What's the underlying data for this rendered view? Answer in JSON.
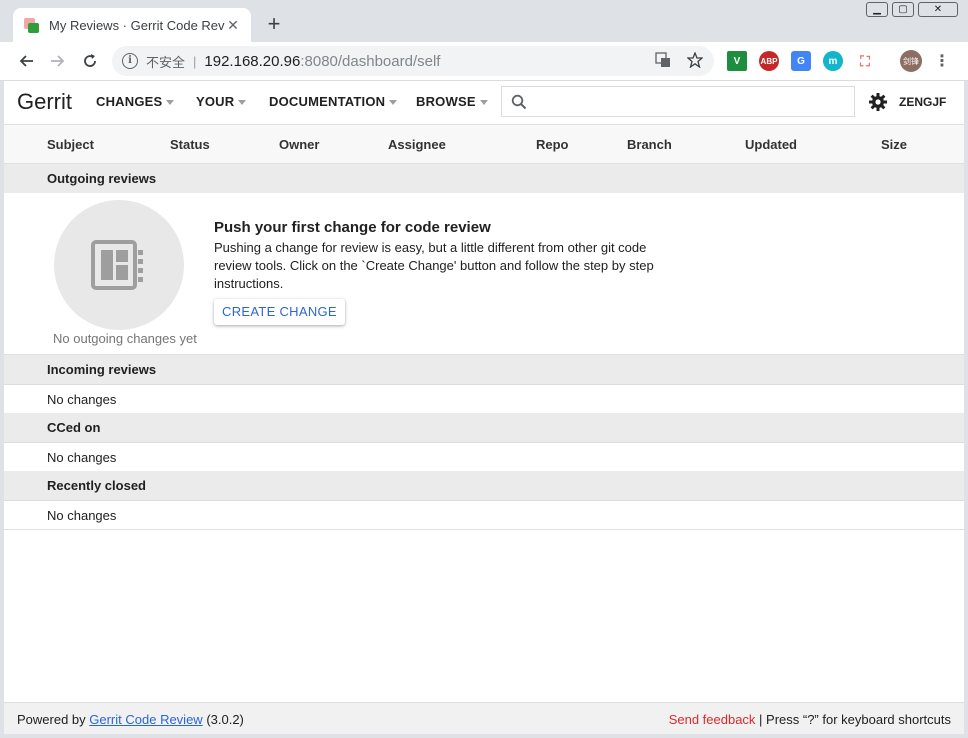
{
  "browser": {
    "tab_title": "My Reviews · Gerrit Code Revie",
    "tab_close": "✕",
    "new_tab": "+",
    "window_controls": {
      "minimize": "▁",
      "maximize": "▢",
      "close": "✕"
    },
    "security_label": "不安全",
    "separator": "|",
    "url_host": "192.168.20.96",
    "url_rest": ":8080/dashboard/self",
    "extensions": [
      {
        "name": "v-extension-icon",
        "label": "V",
        "color": "#1e8e3e"
      },
      {
        "name": "adblock-plus-icon",
        "label": "ABP",
        "color": "#c62828"
      },
      {
        "name": "google-translate-icon",
        "label": "G",
        "color": "#4285f4"
      },
      {
        "name": "m-extension-icon",
        "label": "m",
        "color": "#12b5cb"
      },
      {
        "name": "pdf-icon",
        "label": "⛶",
        "color": "#e57373"
      }
    ],
    "profile_avatar": "剑锋",
    "menu_icon": "⋮"
  },
  "gerrit": {
    "logo": "Gerrit",
    "menu": [
      "CHANGES",
      "YOUR",
      "DOCUMENTATION",
      "BROWSE"
    ],
    "search_placeholder": "",
    "user": "ZENGJF"
  },
  "table": {
    "columns": [
      "Subject",
      "Status",
      "Owner",
      "Assignee",
      "Repo",
      "Branch",
      "Updated",
      "Size"
    ]
  },
  "sections": {
    "outgoing": {
      "title": "Outgoing reviews",
      "empty_caption": "No outgoing changes yet",
      "empty_title": "Push your first change for code review",
      "empty_text": "Pushing a change for review is easy, but a little different from other git code review tools. Click on the `Create Change' button and follow the step by step instructions.",
      "create_button": "CREATE CHANGE"
    },
    "incoming": {
      "title": "Incoming reviews",
      "empty": "No changes"
    },
    "cced": {
      "title": "CCed on",
      "empty": "No changes"
    },
    "closed": {
      "title": "Recently closed",
      "empty": "No changes"
    }
  },
  "footer": {
    "powered_by": "Powered by ",
    "link": "Gerrit Code Review",
    "version": " (3.0.2)",
    "feedback": "Send feedback",
    "separator": " | ",
    "shortcuts": "Press “?” for keyboard shortcuts"
  },
  "colors": {
    "link": "#2a66d9",
    "feedback": "#d92b2b",
    "section_bg": "#ebebeb"
  }
}
